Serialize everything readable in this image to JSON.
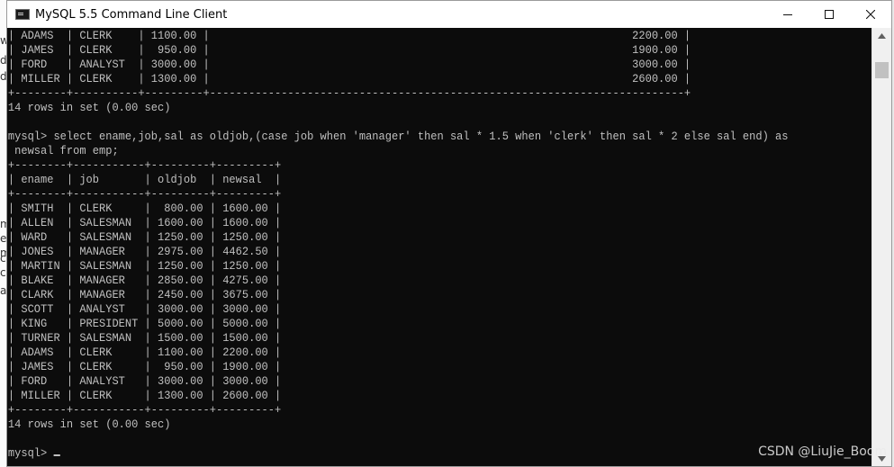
{
  "window": {
    "title": "MySQL 5.5 Command Line Client",
    "controls": {
      "minimize": "minimize",
      "maximize": "maximize",
      "close": "close"
    }
  },
  "background_fragments": [
    "w",
    "d",
    "d",
    "m",
    "e",
    "m",
    "c",
    "c",
    "a"
  ],
  "console": {
    "text_color": "#c0c0c0",
    "background": "#0c0c0c",
    "first_result_tail": {
      "rows": [
        [
          "ADAMS",
          "CLERK",
          "1100.00",
          "2200.00"
        ],
        [
          "JAMES",
          "CLERK",
          "950.00",
          "1900.00"
        ],
        [
          "FORD",
          "ANALYST",
          "3000.00",
          "3000.00"
        ],
        [
          "MILLER",
          "CLERK",
          "1300.00",
          "2600.00"
        ]
      ],
      "footer": "14 rows in set (0.00 sec)"
    },
    "prompt": "mysql>",
    "command_line1": "select ename,job,sal as oldjob,(case job when 'manager' then sal * 1.5 when 'clerk' then sal * 2 else sal end) as",
    "command_line2": "newsal from emp;",
    "result": {
      "columns": [
        "ename",
        "job",
        "oldjob",
        "newsal"
      ],
      "rows": [
        [
          "SMITH",
          "CLERK",
          "800.00",
          "1600.00"
        ],
        [
          "ALLEN",
          "SALESMAN",
          "1600.00",
          "1600.00"
        ],
        [
          "WARD",
          "SALESMAN",
          "1250.00",
          "1250.00"
        ],
        [
          "JONES",
          "MANAGER",
          "2975.00",
          "4462.50"
        ],
        [
          "MARTIN",
          "SALESMAN",
          "1250.00",
          "1250.00"
        ],
        [
          "BLAKE",
          "MANAGER",
          "2850.00",
          "4275.00"
        ],
        [
          "CLARK",
          "MANAGER",
          "2450.00",
          "3675.00"
        ],
        [
          "SCOTT",
          "ANALYST",
          "3000.00",
          "3000.00"
        ],
        [
          "KING",
          "PRESIDENT",
          "5000.00",
          "5000.00"
        ],
        [
          "TURNER",
          "SALESMAN",
          "1500.00",
          "1500.00"
        ],
        [
          "ADAMS",
          "CLERK",
          "1100.00",
          "2200.00"
        ],
        [
          "JAMES",
          "CLERK",
          "950.00",
          "1900.00"
        ],
        [
          "FORD",
          "ANALYST",
          "3000.00",
          "3000.00"
        ],
        [
          "MILLER",
          "CLERK",
          "1300.00",
          "2600.00"
        ]
      ],
      "footer": "14 rows in set (0.00 sec)"
    },
    "final_prompt": "mysql>"
  },
  "watermark": "CSDN @LiuJie_Boom"
}
